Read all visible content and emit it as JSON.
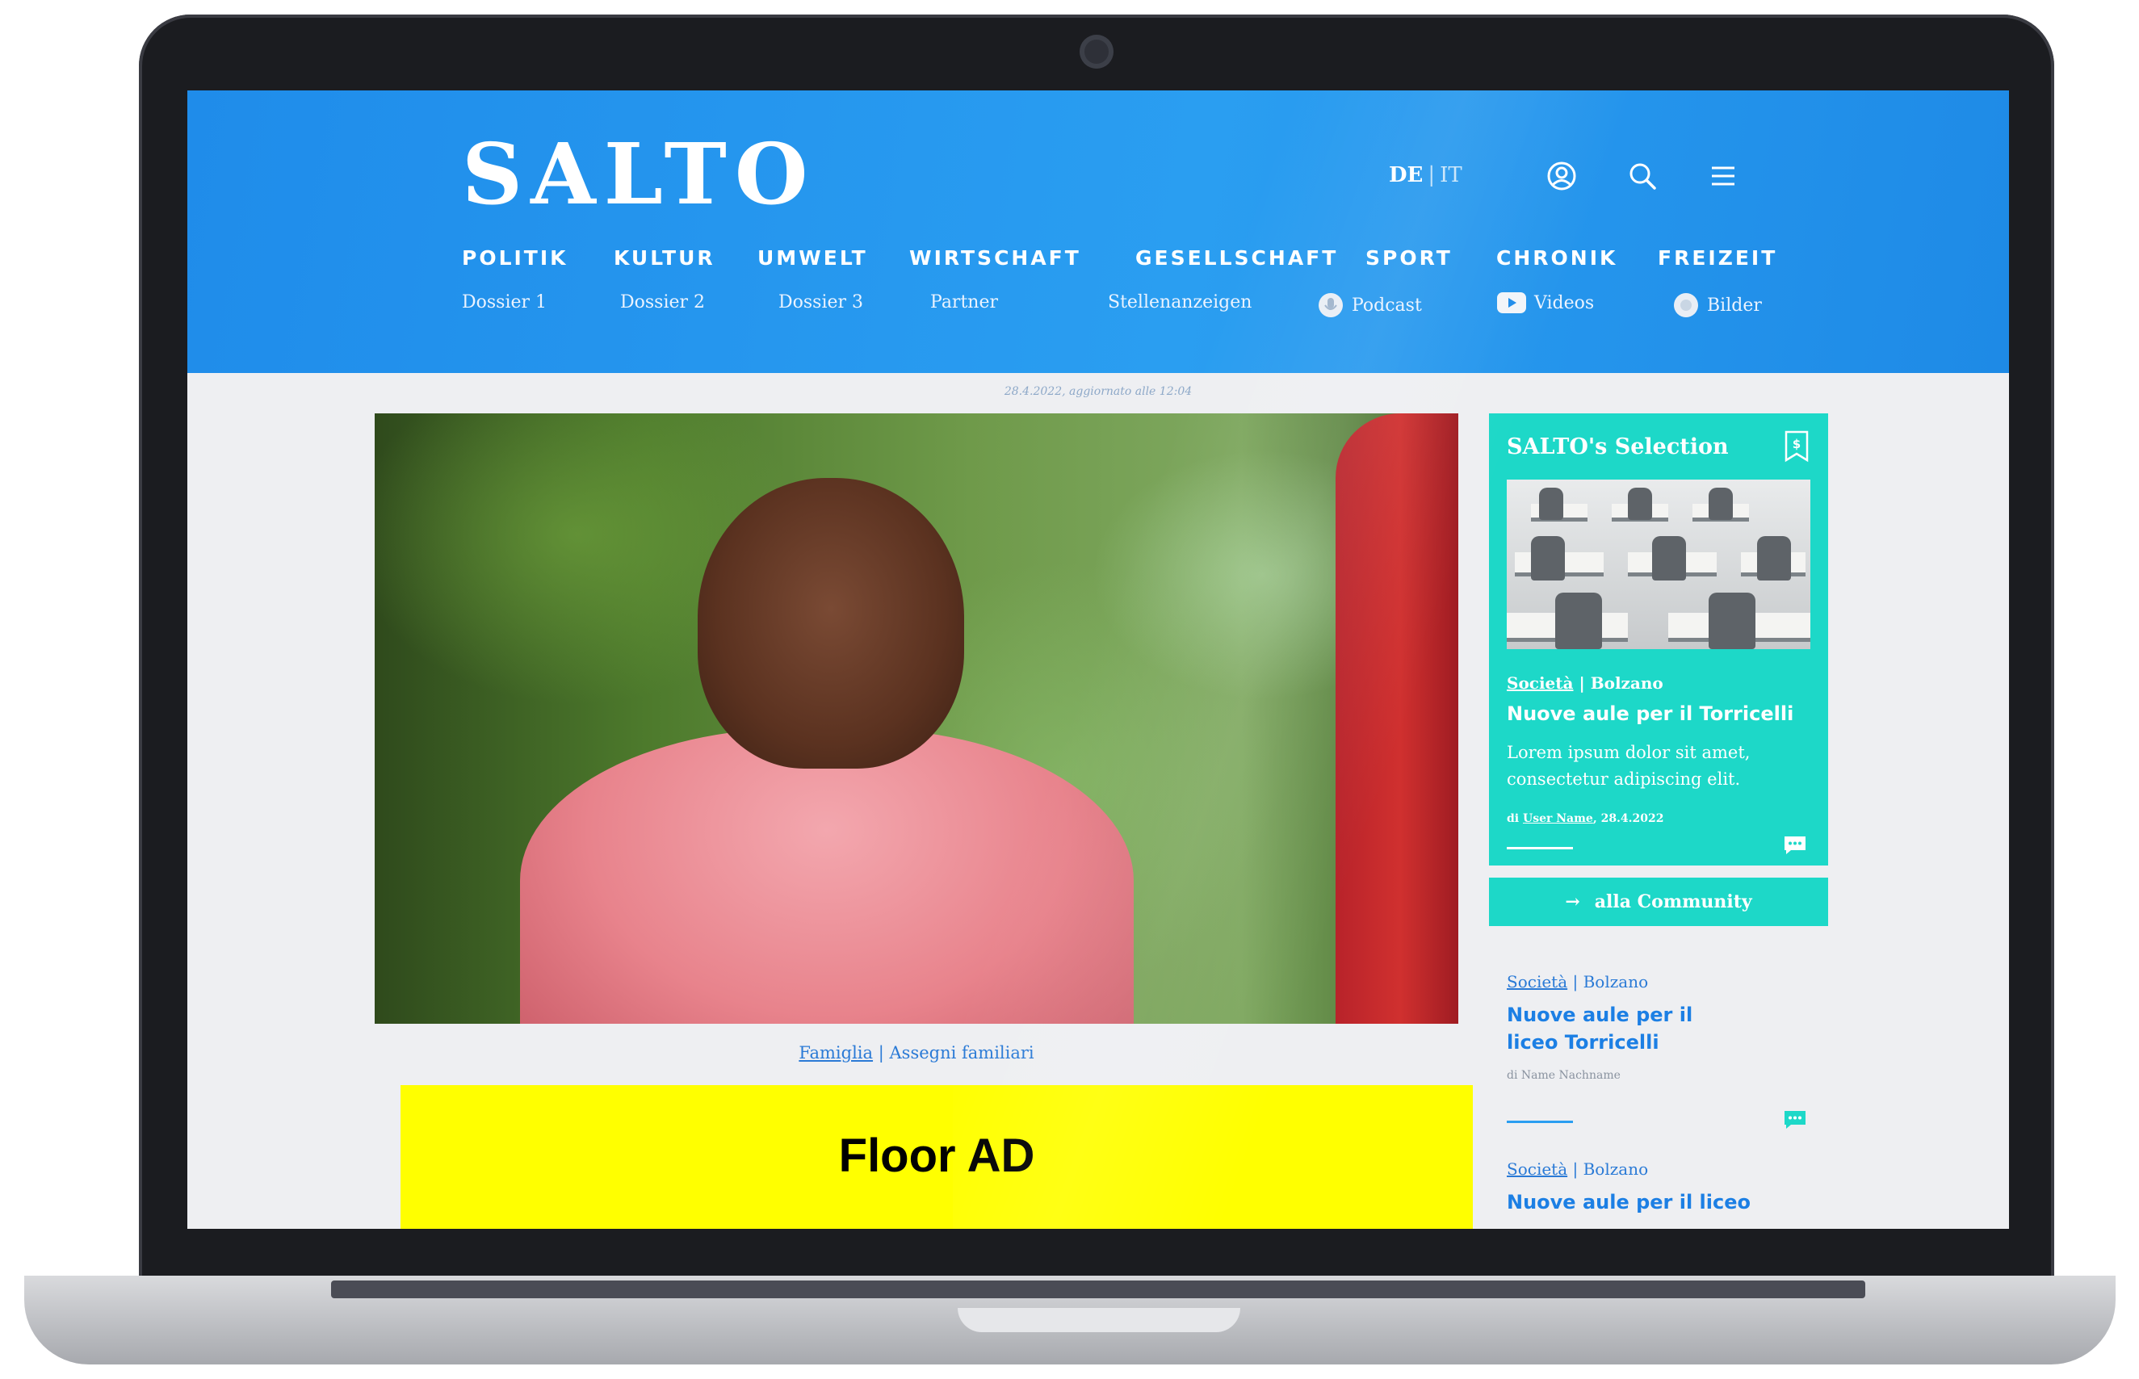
{
  "site": {
    "logo": "SALTO",
    "lang_de": "DE",
    "lang_sep": "|",
    "lang_it": "IT"
  },
  "nav": [
    "POLITIK",
    "KULTUR",
    "UMWELT",
    "WIRTSCHAFT",
    "GESELLSCHAFT",
    "SPORT",
    "CHRONIK",
    "FREIZEIT"
  ],
  "subnav": {
    "dossier1": "Dossier 1",
    "dossier2": "Dossier 2",
    "dossier3": "Dossier 3",
    "partner": "Partner",
    "jobs": "Stellenanzeigen",
    "podcast": "Podcast",
    "videos": "Videos",
    "bilder": "Bilder"
  },
  "article": {
    "date": "28.4.2022, aggiornato alle 12:04",
    "category": "Famiglia",
    "sep": "|",
    "tag": "Assegni familiari"
  },
  "ad": {
    "label": "Floor AD"
  },
  "selection": {
    "title": "SALTO's Selection",
    "category": "Società",
    "sep": "|",
    "place": "Bolzano",
    "headline": "Nuove aule per il Torricelli",
    "excerpt": "Lorem ipsum dolor sit amet, consectetur adipiscing elit.",
    "author_prefix": "di",
    "author": "User Name",
    "author_date": ", 28.4.2022"
  },
  "community": {
    "label": "alla Community",
    "arrow": "→"
  },
  "side_articles": [
    {
      "category": "Società",
      "sep": "|",
      "place": "Bolzano",
      "headline": "Nuove aule per il liceo Torricelli",
      "author": "di Name Nachname"
    },
    {
      "category": "Società",
      "sep": "|",
      "place": "Bolzano",
      "headline": "Nuove aule per il liceo"
    }
  ],
  "colors": {
    "header_blue": "#2196ef",
    "accent_teal": "#1dd8c8",
    "ad_yellow": "#ffff00",
    "link_blue": "#1c7fe4"
  },
  "icons": [
    "user-icon",
    "search-icon",
    "menu-icon",
    "bookmark-icon",
    "microphone-icon",
    "play-icon",
    "image-icon",
    "comment-icon",
    "arrow-right-icon"
  ]
}
